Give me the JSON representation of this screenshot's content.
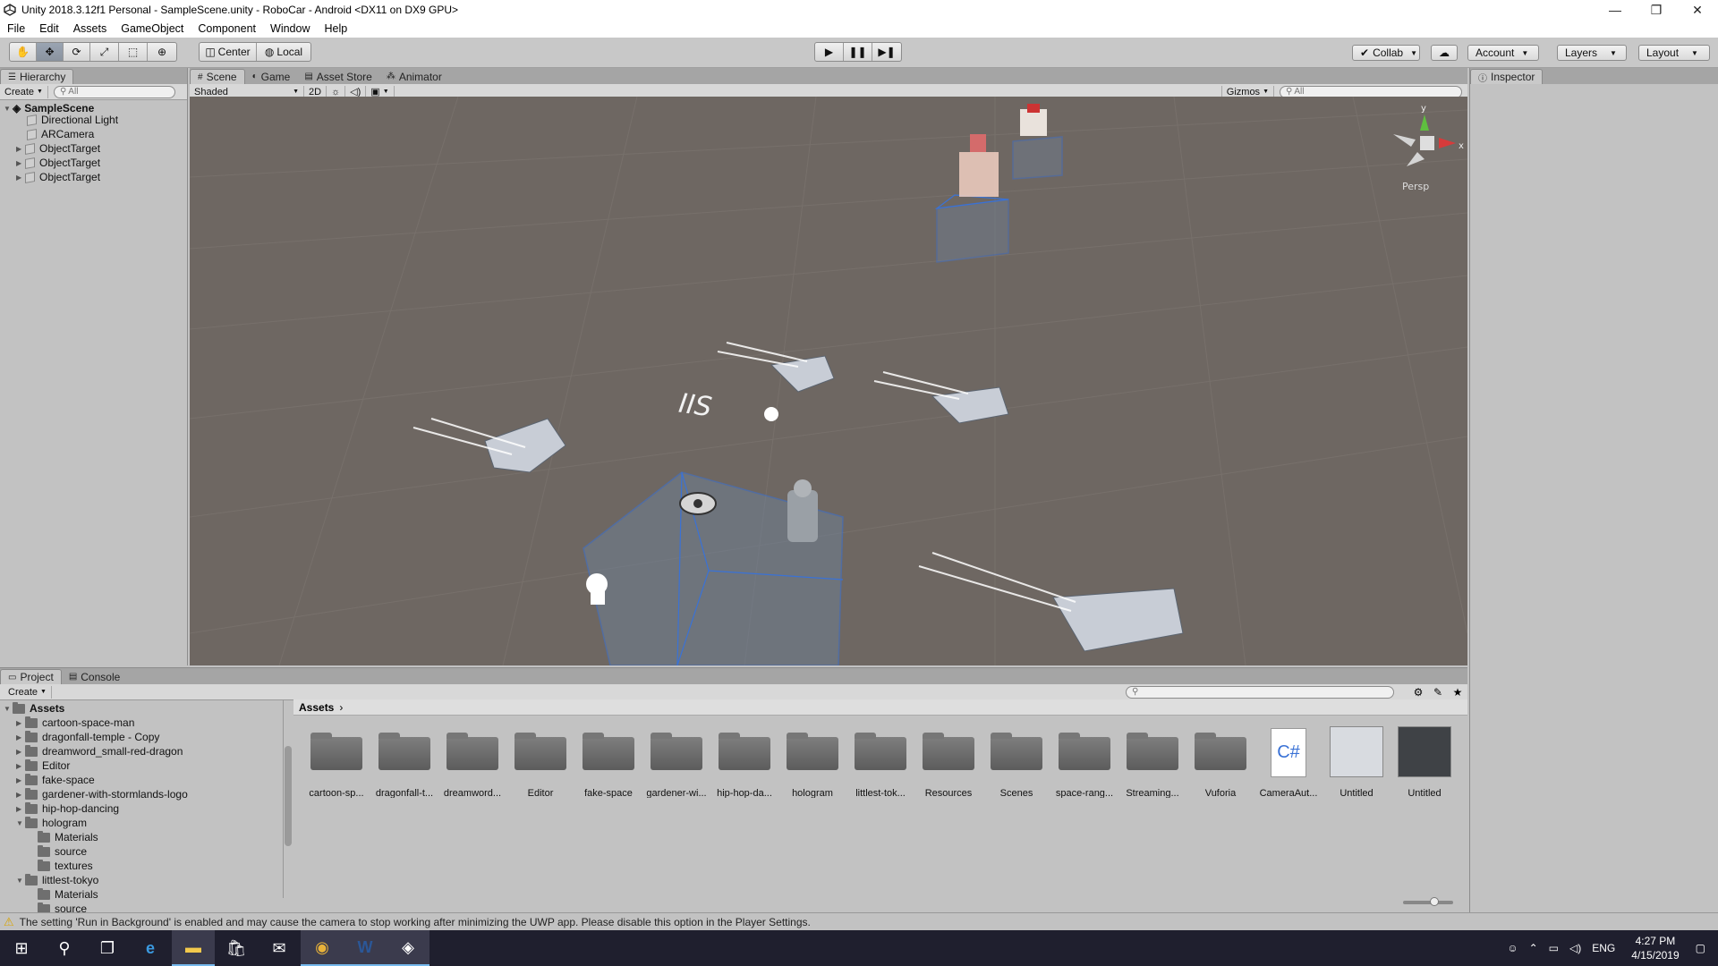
{
  "window": {
    "title": "Unity 2018.3.12f1 Personal - SampleScene.unity - RoboCar - Android <DX11 on DX9 GPU>",
    "minimize": "—",
    "restore": "❐",
    "close": "✕"
  },
  "menu": [
    "File",
    "Edit",
    "Assets",
    "GameObject",
    "Component",
    "Window",
    "Help"
  ],
  "toolbar": {
    "center": "Center",
    "local": "Local",
    "collab": "Collab",
    "account": "Account",
    "layers": "Layers",
    "layout": "Layout"
  },
  "hierarchy": {
    "tab": "Hierarchy",
    "create": "Create",
    "search_placeholder": "All",
    "scene": "SampleScene",
    "items": [
      "Directional Light",
      "ARCamera",
      "ObjectTarget",
      "ObjectTarget",
      "ObjectTarget"
    ]
  },
  "scene_tabs": {
    "scene": "Scene",
    "game": "Game",
    "asset_store": "Asset Store",
    "animator": "Animator",
    "shaded": "Shaded",
    "two_d": "2D",
    "gizmos": "Gizmos",
    "search_placeholder": "All",
    "persp": "Persp",
    "scene_text": "IIS",
    "axis_y": "y",
    "axis_x": "x"
  },
  "inspector": {
    "tab": "Inspector"
  },
  "project": {
    "tab": "Project",
    "console_tab": "Console",
    "create": "Create",
    "root": "Assets",
    "breadcrumb": "Assets",
    "tree": [
      {
        "label": "cartoon-space-man",
        "level": 1,
        "expanded": false
      },
      {
        "label": "dragonfall-temple - Copy",
        "level": 1,
        "expanded": false
      },
      {
        "label": "dreamword_small-red-dragon",
        "level": 1,
        "expanded": false
      },
      {
        "label": "Editor",
        "level": 1,
        "expanded": false
      },
      {
        "label": "fake-space",
        "level": 1,
        "expanded": false
      },
      {
        "label": "gardener-with-stormlands-logo",
        "level": 1,
        "expanded": false
      },
      {
        "label": "hip-hop-dancing",
        "level": 1,
        "expanded": false
      },
      {
        "label": "hologram",
        "level": 1,
        "expanded": true
      },
      {
        "label": "Materials",
        "level": 2,
        "expanded": false
      },
      {
        "label": "source",
        "level": 2,
        "expanded": false
      },
      {
        "label": "textures",
        "level": 2,
        "expanded": false
      },
      {
        "label": "littlest-tokyo",
        "level": 1,
        "expanded": true
      },
      {
        "label": "Materials",
        "level": 2,
        "expanded": false
      },
      {
        "label": "source",
        "level": 2,
        "expanded": false
      }
    ],
    "assets": [
      {
        "label": "cartoon-sp...",
        "kind": "folder"
      },
      {
        "label": "dragonfall-t...",
        "kind": "folder"
      },
      {
        "label": "dreamword...",
        "kind": "folder"
      },
      {
        "label": "Editor",
        "kind": "folder"
      },
      {
        "label": "fake-space",
        "kind": "folder"
      },
      {
        "label": "gardener-wi...",
        "kind": "folder"
      },
      {
        "label": "hip-hop-da...",
        "kind": "folder"
      },
      {
        "label": "hologram",
        "kind": "folder"
      },
      {
        "label": "littlest-tok...",
        "kind": "folder"
      },
      {
        "label": "Resources",
        "kind": "folder"
      },
      {
        "label": "Scenes",
        "kind": "folder"
      },
      {
        "label": "space-rang...",
        "kind": "folder"
      },
      {
        "label": "Streaming...",
        "kind": "folder"
      },
      {
        "label": "Vuforia",
        "kind": "folder"
      },
      {
        "label": "CameraAut...",
        "kind": "script",
        "badge": "C#"
      },
      {
        "label": "Untitled",
        "kind": "prefab-robot"
      },
      {
        "label": "Untitled",
        "kind": "prefab-dark"
      }
    ]
  },
  "status": {
    "message": "The setting 'Run in Background' is enabled and may cause the camera to stop working after minimizing the UWP app. Please disable this option in the Player Settings."
  },
  "taskbar": {
    "lang": "ENG",
    "time": "4:27 PM",
    "date": "4/15/2019"
  },
  "colors": {
    "scene_bg": "#6e6762",
    "panel_bg": "#c2c2c2",
    "selection_blue": "#3a72d6",
    "taskbar": "#1f1f2e"
  }
}
